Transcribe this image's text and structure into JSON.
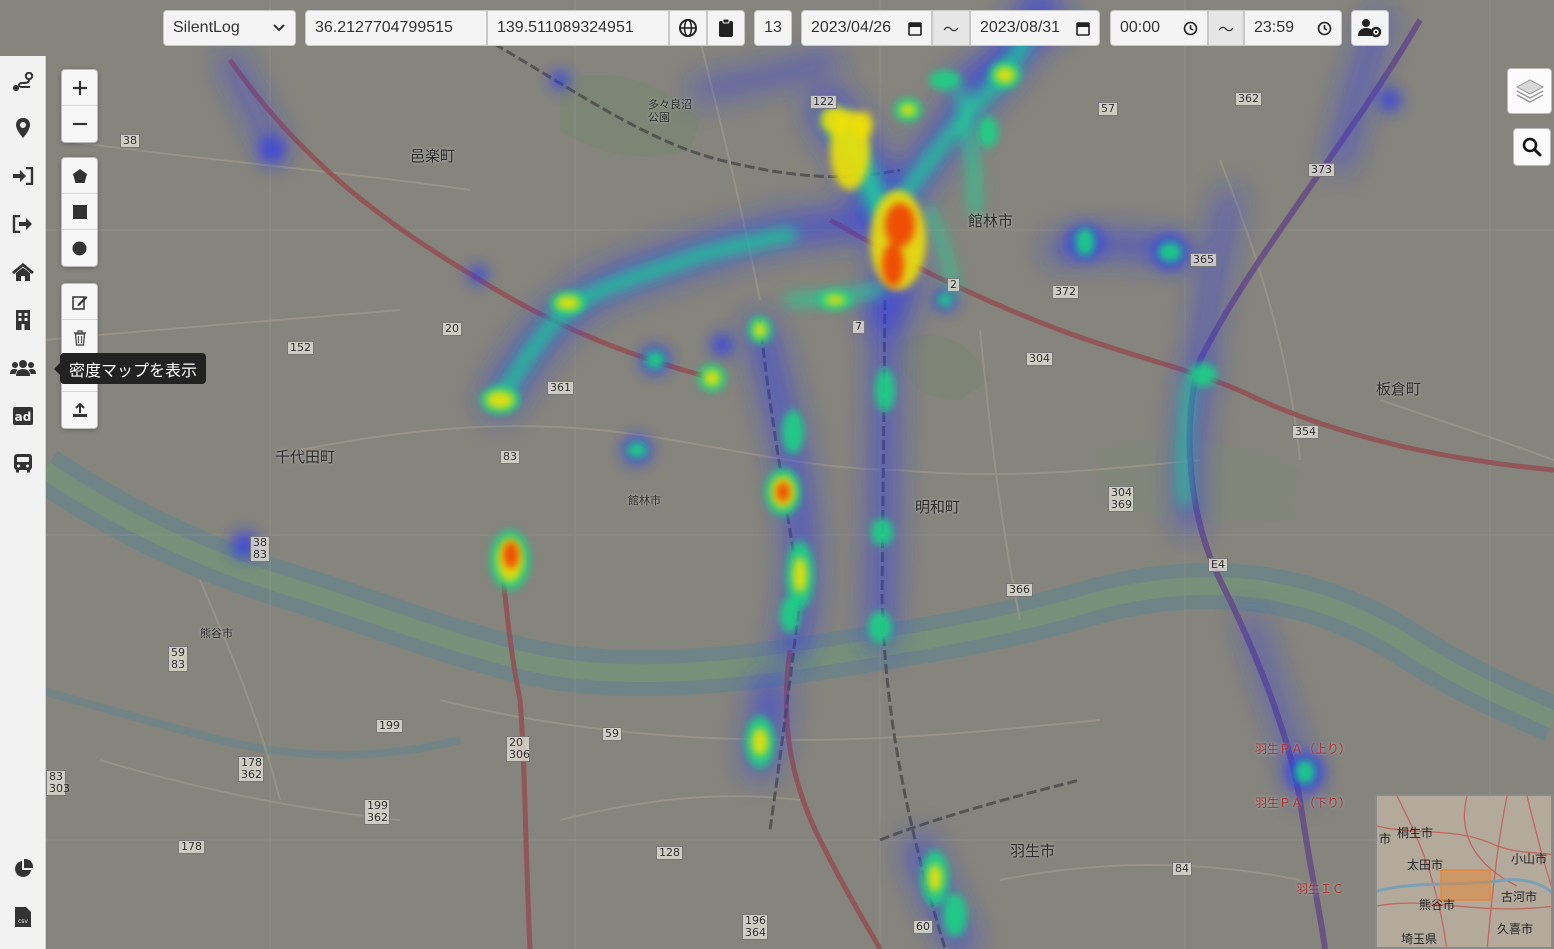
{
  "toolbar": {
    "source_select": "SilentLog",
    "latitude": "36.2127704799515",
    "longitude": "139.511089324951",
    "zoom": "13",
    "date_from": "2023/04/26",
    "date_to": "2023/08/31",
    "range_sep": "〜",
    "time_from": "00:00",
    "time_to": "23:59"
  },
  "tooltip": "密度マップを表示",
  "map": {
    "towns": [
      {
        "id": "oura",
        "text": "邑楽町"
      },
      {
        "id": "chiyoda",
        "text": "千代田町"
      },
      {
        "id": "tatebayashi",
        "text": "館林市"
      },
      {
        "id": "meiwa",
        "text": "明和町"
      },
      {
        "id": "itakura",
        "text": "板倉町"
      },
      {
        "id": "hanyu",
        "text": "羽生市"
      },
      {
        "id": "kumagaya",
        "text": "熊谷市"
      },
      {
        "id": "tatebayashi_small",
        "text": "館林市"
      },
      {
        "id": "tamonoike",
        "text": "多々良沼公園"
      }
    ],
    "routes": [
      "38",
      "20",
      "152",
      "361",
      "83",
      "122",
      "57",
      "362",
      "373",
      "365",
      "372",
      "304",
      "354",
      "304 369",
      "366",
      "E4",
      "38 83",
      "59 83",
      "199",
      "20 306",
      "59",
      "178 362",
      "199 362",
      "178",
      "128",
      "196 364",
      "60",
      "84",
      "7",
      "2",
      "83 303"
    ],
    "pa": [
      {
        "id": "pa-up",
        "text": "羽生ＰＡ（上り）"
      },
      {
        "id": "pa-down",
        "text": "羽生ＰＡ（下り）"
      },
      {
        "id": "ic",
        "text": "羽生ＩＣ"
      }
    ]
  },
  "minimap": {
    "labels": [
      "桐生市",
      "太田市",
      "小山市",
      "古河市",
      "熊谷市",
      "久喜市",
      "埼玉県",
      "市"
    ]
  },
  "colors": {
    "heat_low": "#2b3cff",
    "heat_mid": "#18e0a0",
    "heat_high": "#ffef00",
    "heat_max": "#ff3b00",
    "sidebar": "#f2f2f2"
  },
  "icons": {
    "sidebar": [
      "route-icon",
      "map-pin-icon",
      "sign-in-icon",
      "sign-out-icon",
      "home-icon",
      "building-icon",
      "users-icon",
      "ad-icon",
      "bus-icon",
      "pie-chart-icon",
      "csv-file-icon"
    ],
    "controls": [
      "zoom-in-icon",
      "zoom-out-icon",
      "polygon-icon",
      "square-icon",
      "circle-icon",
      "edit-icon",
      "trash-icon",
      "download-icon",
      "upload-icon"
    ]
  }
}
